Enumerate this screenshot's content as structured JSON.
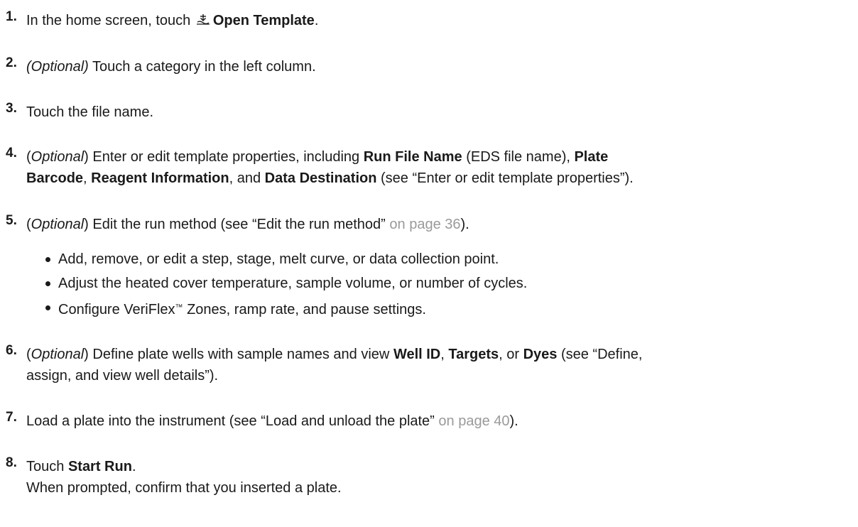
{
  "steps": [
    {
      "num": "1.",
      "pre": "In the home screen, touch",
      "icon": "open-template-icon",
      "bold": "Open Template",
      "post": "."
    },
    {
      "num": "2.",
      "italic": "(Optional)",
      "text": " Touch a category in the left column."
    },
    {
      "num": "3.",
      "text": "Touch the file name."
    },
    {
      "num": "4.",
      "p1": "(",
      "italic": "Optional",
      "p2": ") Enter or edit template properties, including ",
      "b1": "Run File Name",
      "p3": " (EDS file name), ",
      "b2": "Plate",
      "b2b": "Barcode",
      "p4": ", ",
      "b3": "Reagent Information",
      "p5": ", and ",
      "b4": "Data Destination",
      "p6": " (see “Enter or edit template properties”)."
    },
    {
      "num": "5.",
      "p1": "(",
      "italic": "Optional",
      "p2": ") Edit the run method (see “Edit the run method” ",
      "link": "on page 36",
      "p3": ").",
      "bullets": [
        "Add, remove, or edit a step, stage, melt curve, or data collection point.",
        "Adjust the heated cover temperature, sample volume, or number of cycles."
      ],
      "bullet3_pre": "Configure VeriFlex",
      "bullet3_tm": "™",
      "bullet3_post": " Zones, ramp rate, and pause settings."
    },
    {
      "num": "6.",
      "p1": "(",
      "italic": "Optional",
      "p2": ") Define plate wells with sample names and view ",
      "b1": "Well ID",
      "p3": ", ",
      "b2": "Targets",
      "p4": ", or ",
      "b3": "Dyes",
      "p5": " (see “Define,",
      "line2": "assign, and view well details”)."
    },
    {
      "num": "7.",
      "p1": "Load a plate into the instrument (see “Load and unload the plate” ",
      "link": "on page 40",
      "p2": ")."
    },
    {
      "num": "8.",
      "pre": "Touch ",
      "bold": "Start Run",
      "post": ".",
      "line2": "When prompted, confirm that you inserted a plate."
    }
  ]
}
